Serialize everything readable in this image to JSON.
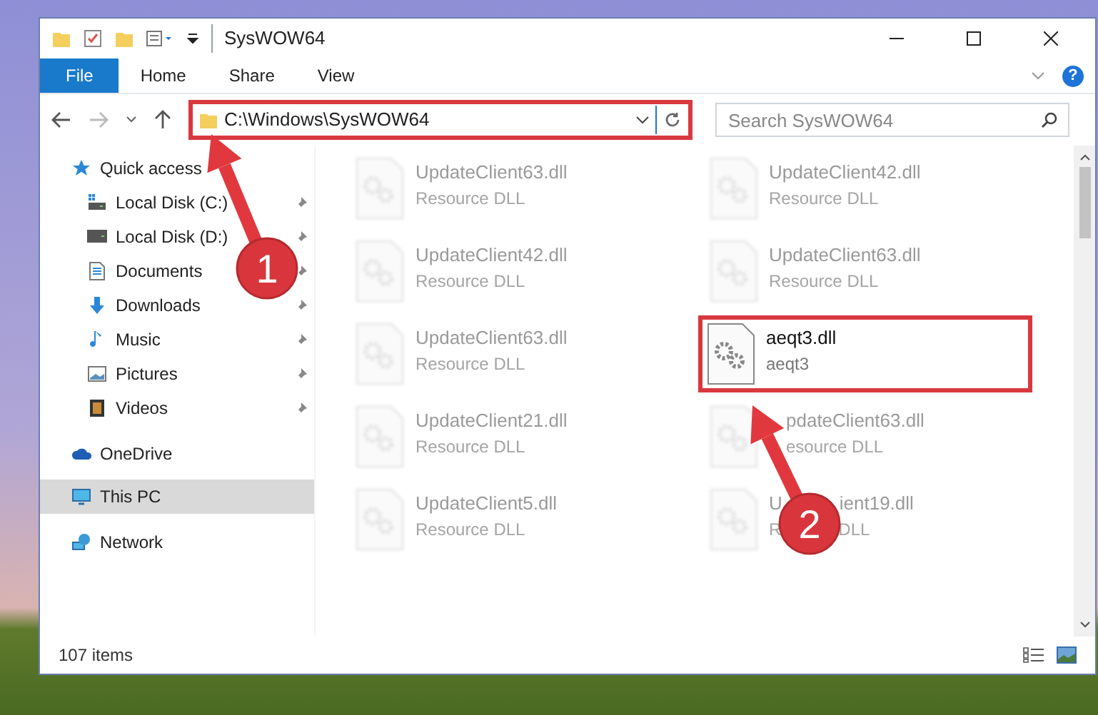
{
  "window": {
    "title": "SysWOW64"
  },
  "ribbon_tabs": [
    {
      "label": "File",
      "selected": true
    },
    {
      "label": "Home",
      "selected": false
    },
    {
      "label": "Share",
      "selected": false
    },
    {
      "label": "View",
      "selected": false
    }
  ],
  "help": "?",
  "address_bar": {
    "path": "C:\\Windows\\SysWOW64",
    "highlighted": true
  },
  "search": {
    "placeholder": "Search SysWOW64"
  },
  "sidebar": {
    "items": [
      {
        "label": "Quick access",
        "kind": "star",
        "selected": false,
        "children": [
          {
            "label": "Local Disk (C:)",
            "kind": "diskc",
            "selected": false,
            "pinned": true
          },
          {
            "label": "Local Disk (D:)",
            "kind": "disk",
            "selected": false,
            "pinned": true
          },
          {
            "label": "Documents",
            "kind": "docs",
            "selected": false,
            "pinned": true
          },
          {
            "label": "Downloads",
            "kind": "down",
            "selected": false,
            "pinned": true
          },
          {
            "label": "Music",
            "kind": "music",
            "selected": false,
            "pinned": true
          },
          {
            "label": "Pictures",
            "kind": "pics",
            "selected": false,
            "pinned": true
          },
          {
            "label": "Videos",
            "kind": "video",
            "selected": false,
            "pinned": true
          }
        ]
      },
      {
        "label": "OneDrive",
        "kind": "cloud",
        "selected": false
      },
      {
        "label": "This PC",
        "kind": "pc",
        "selected": true
      },
      {
        "label": "Network",
        "kind": "net",
        "selected": false
      }
    ]
  },
  "files": [
    {
      "name_parts": [
        "UpdateClient63.dll"
      ],
      "type_parts": [
        "Resource DLL"
      ],
      "kind": "plain",
      "blurred": true,
      "highlighted": false
    },
    {
      "name_parts": [
        "UpdateClient42.dll"
      ],
      "type_parts": [
        "Resource DLL"
      ],
      "kind": "plain",
      "blurred": true,
      "highlighted": false
    },
    {
      "name_parts": [
        "UpdateClient42.dll"
      ],
      "type_parts": [
        "Resource DLL"
      ],
      "kind": "plain",
      "blurred": true,
      "highlighted": false
    },
    {
      "name_parts": [
        "UpdateClient63.dll"
      ],
      "type_parts": [
        "Resource DLL"
      ],
      "kind": "plain",
      "blurred": true,
      "highlighted": false
    },
    {
      "name_parts": [
        "UpdateClient63.dll"
      ],
      "type_parts": [
        "Resource DLL"
      ],
      "kind": "plain",
      "blurred": true,
      "highlighted": false
    },
    {
      "name_parts": [
        "aeqt3.dll"
      ],
      "type_parts": [
        "aeqt3"
      ],
      "kind": "plain",
      "blurred": false,
      "highlighted": true
    },
    {
      "name_parts": [
        "UpdateClient21.dll"
      ],
      "type_parts": [
        "Resource DLL"
      ],
      "kind": "plain",
      "blurred": true,
      "highlighted": false
    },
    {
      "name_parts": [
        "pdateClient63.dll"
      ],
      "type_parts": [
        "esource DLL"
      ],
      "kind": "leftcut",
      "blurred": true,
      "highlighted": false
    },
    {
      "name_parts": [
        "UpdateClient5.dll"
      ],
      "type_parts": [
        "Resource DLL"
      ],
      "kind": "plain",
      "blurred": true,
      "highlighted": false
    },
    {
      "name_parts": [
        "U",
        "ient19.dll"
      ],
      "type_parts": [
        "R",
        "DLL"
      ],
      "kind": "midcut",
      "blurred": true,
      "highlighted": false
    }
  ],
  "status_bar": {
    "count": "107 items"
  },
  "callouts": [
    {
      "label": "1"
    },
    {
      "label": "2"
    }
  ]
}
